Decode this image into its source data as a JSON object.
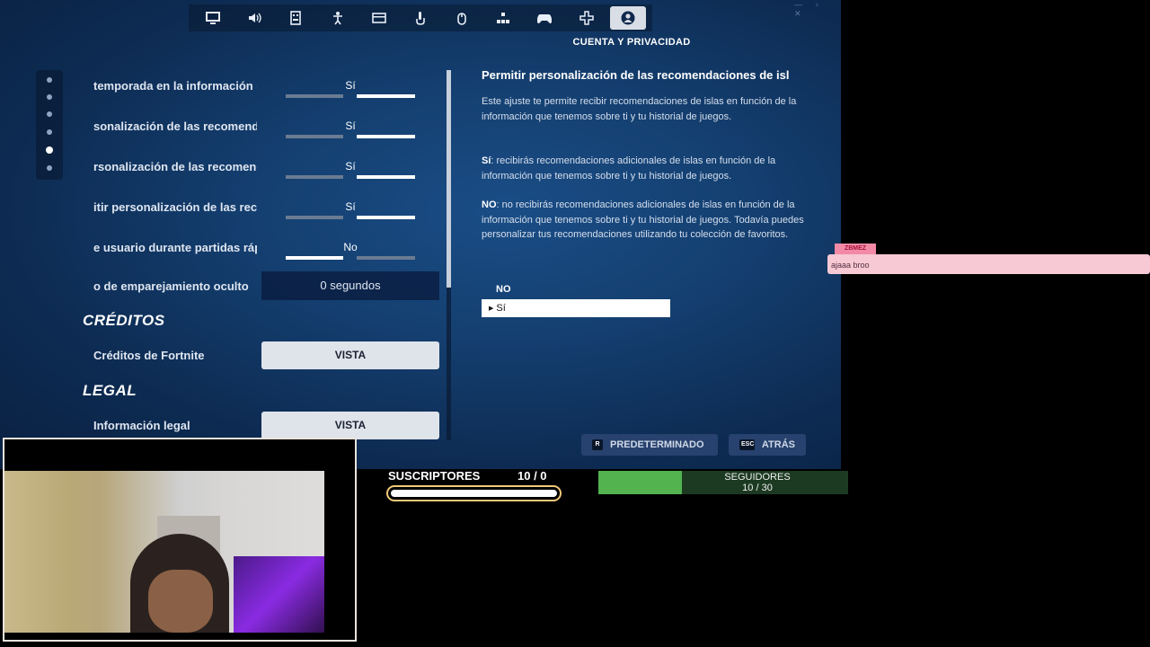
{
  "nav": {
    "tabs": [
      {
        "icon": "monitor-icon"
      },
      {
        "icon": "speaker-icon"
      },
      {
        "icon": "game-settings-icon"
      },
      {
        "icon": "accessibility-icon"
      },
      {
        "icon": "input-icon"
      },
      {
        "icon": "touch-icon"
      },
      {
        "icon": "mouse-keyboard-icon"
      },
      {
        "icon": "controller-config-icon"
      },
      {
        "icon": "gamepad-icon"
      },
      {
        "icon": "controller-input-icon"
      },
      {
        "icon": "account-icon",
        "active": true
      }
    ],
    "section_title": "CUENTA Y PRIVACIDAD"
  },
  "settings": {
    "rows": [
      {
        "label": "temporada en la información de",
        "value": "Sí",
        "on": "right"
      },
      {
        "label": "sonalización de las recomendaciones",
        "value": "Sí",
        "on": "right"
      },
      {
        "label": "rsonalización de las recomendaciones",
        "value": "Sí",
        "on": "right"
      },
      {
        "label": "itir personalización de las recomendaciones",
        "value": "Sí",
        "on": "right"
      },
      {
        "label": "e usuario durante partidas rápidas",
        "value": "No",
        "on": "left"
      }
    ],
    "matchmaking": {
      "label": "o de emparejamiento oculto",
      "value": "0 segundos"
    },
    "credits_heading": "CRÉDITOS",
    "credits_label": "Créditos de Fortnite",
    "credits_button": "VISTA",
    "legal_heading": "LEGAL",
    "legal_label": "Información legal",
    "legal_button": "VISTA"
  },
  "info": {
    "title": "Permitir personalización de las recomendaciones de isl",
    "p1": "Este ajuste te permite recibir recomendaciones de islas en función de la información que tenemos sobre ti y tu historial de juegos.",
    "p2_key": "Sí",
    "p2": ": recibirás recomendaciones adicionales de islas en función de la información que tenemos sobre ti y tu historial de juegos.",
    "p3_key": "NO",
    "p3": ": no recibirás recomendaciones adicionales de islas en función de la información que tenemos sobre ti y tu historial de juegos. Todavía puedes personalizar tus recomendaciones utilizando tu colección de favoritos.",
    "options": [
      "NO",
      "Sí"
    ],
    "selected": "Sí"
  },
  "footer": {
    "default_key": "R",
    "default_label": "PREDETERMINADO",
    "back_key": "ESC",
    "back_label": "ATRÁS"
  },
  "overlay": {
    "chat_user": "ZBMEZ",
    "chat_message": "ajaaa broo",
    "subs_label": "SUSCRIPTORES",
    "subs_count": "10  / 0",
    "subs_progress": 1.0,
    "followers_label": "SEGUIDORES",
    "followers_count": "10 / 30",
    "followers_progress": 0.333
  },
  "colors": {
    "followers_fill": "#52b34f",
    "subs_border": "#f1c878",
    "chat_bg": "#f6c9d4"
  }
}
